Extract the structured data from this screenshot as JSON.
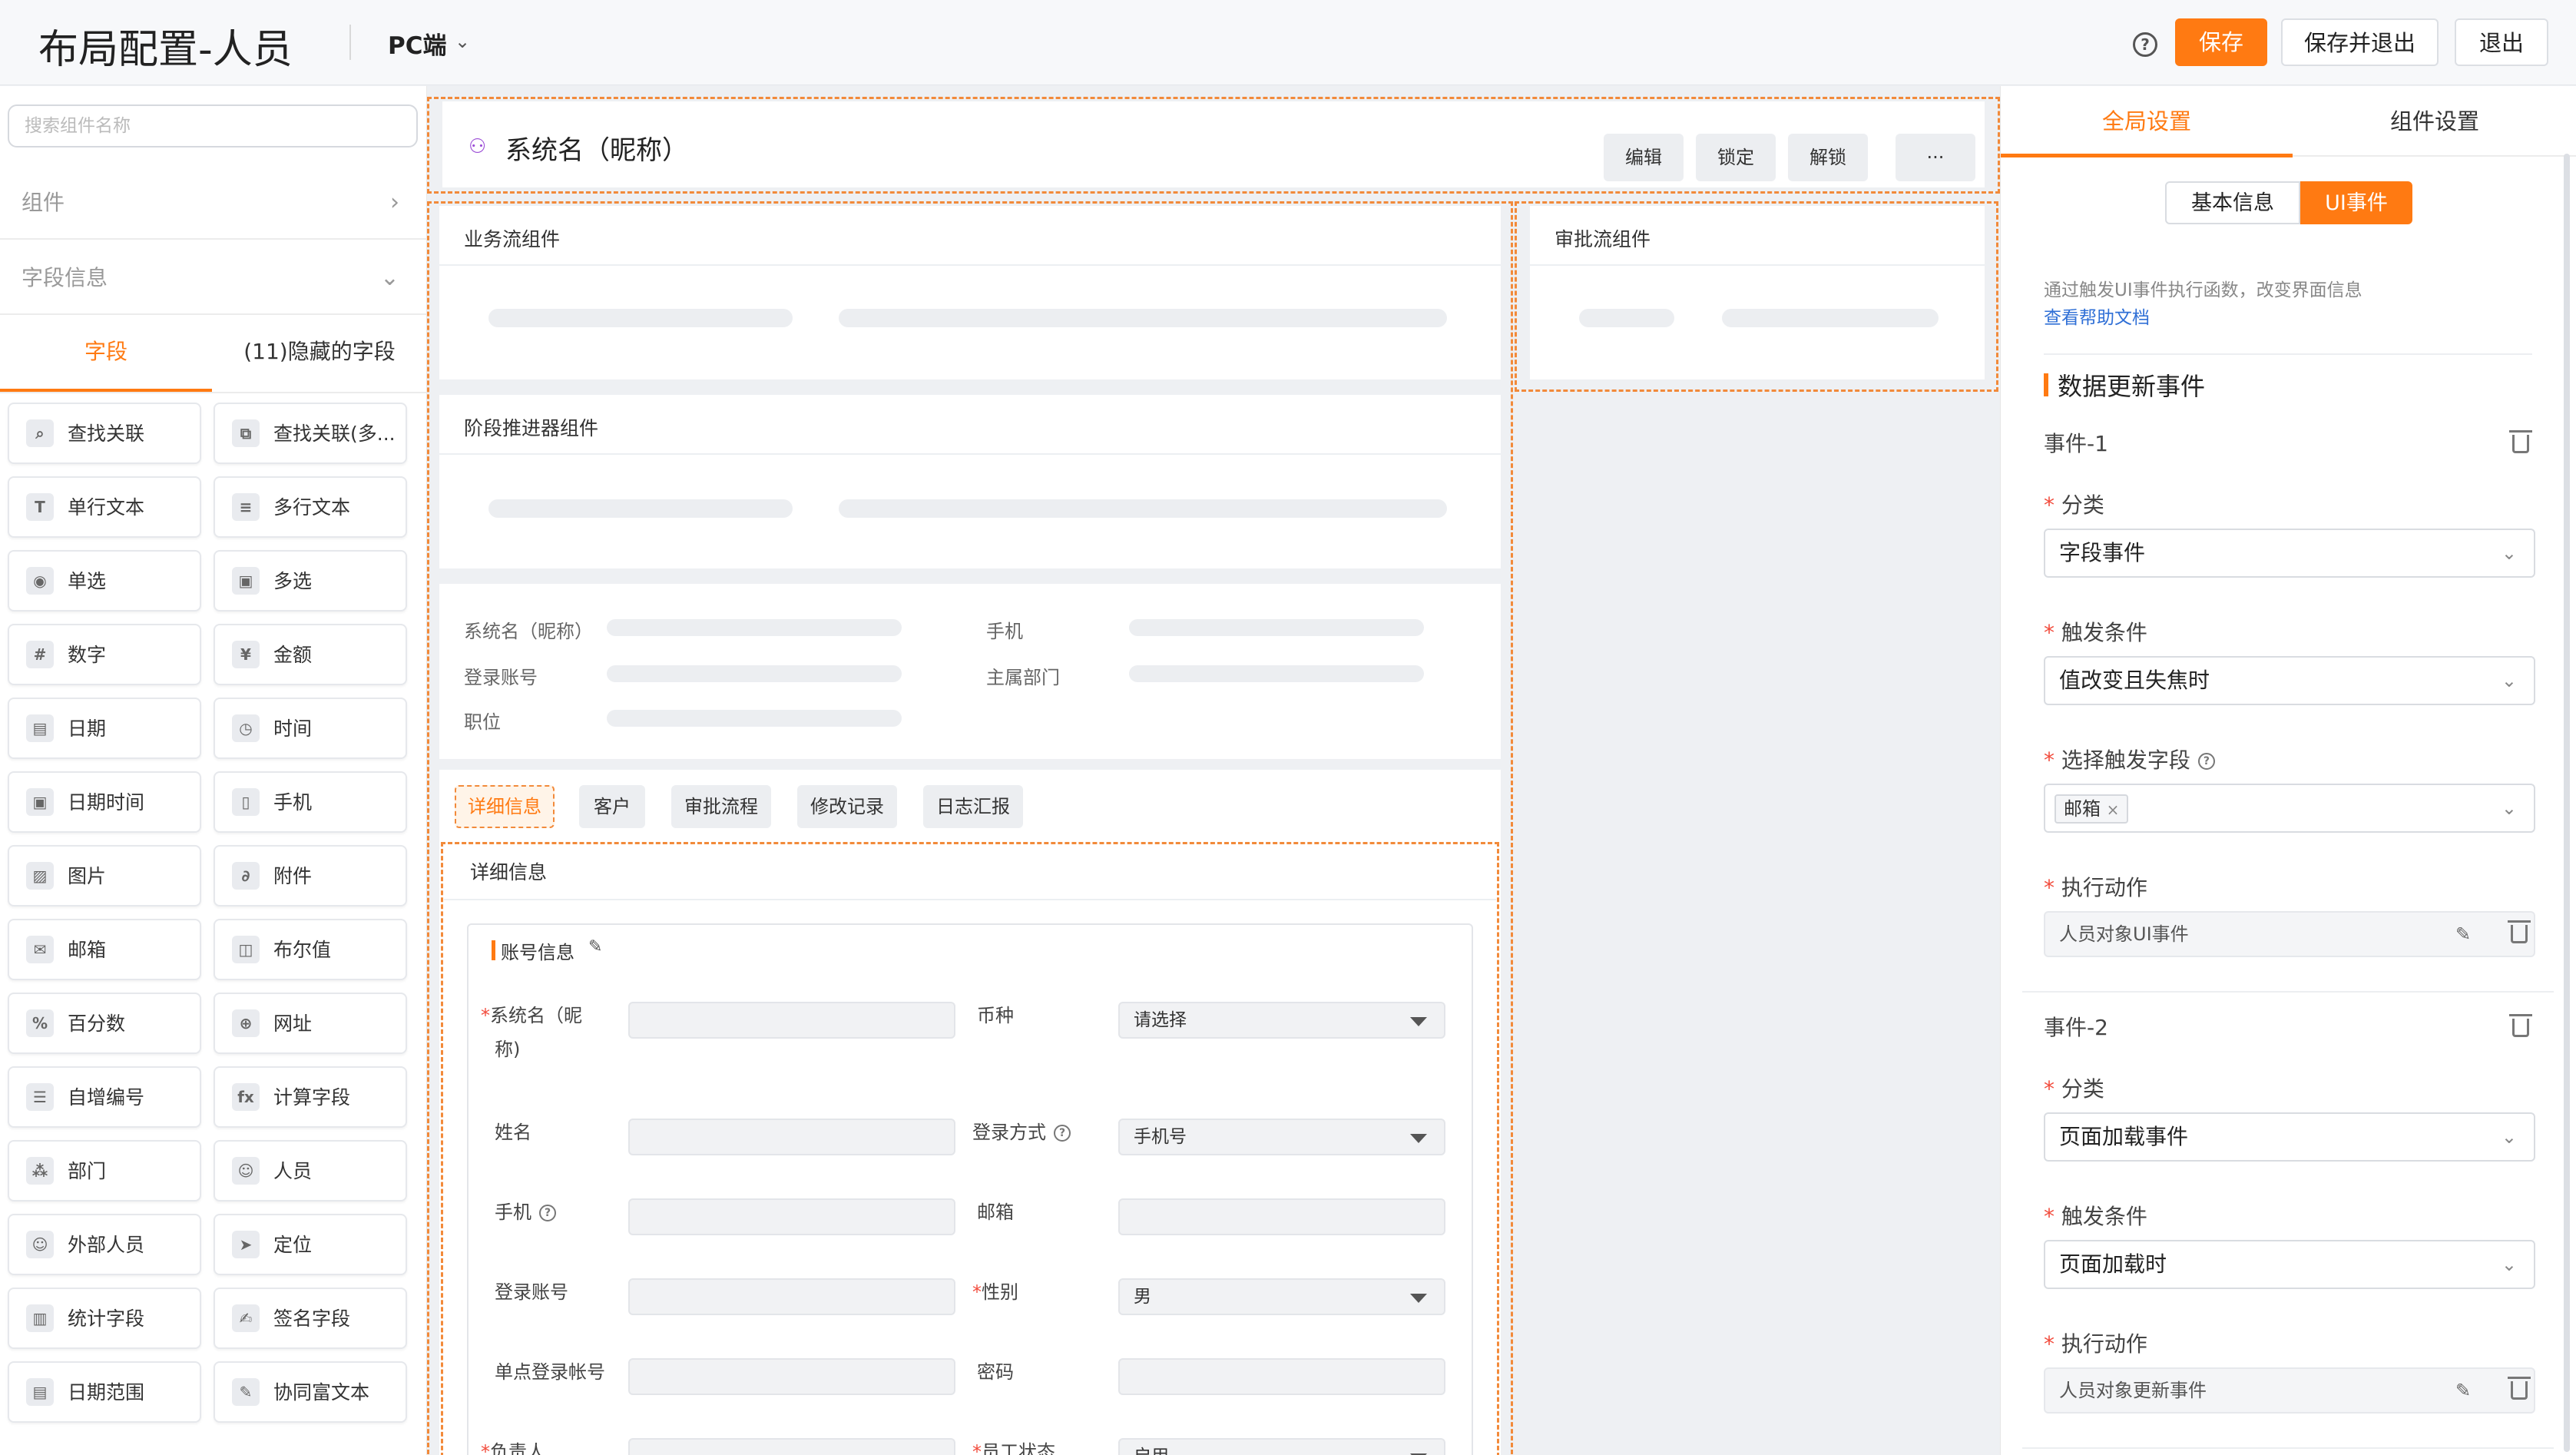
{
  "header": {
    "title": "布局配置-人员",
    "platform": "PC端",
    "help_icon": "?",
    "save": "保存",
    "save_exit": "保存并退出",
    "exit": "退出",
    "accent": "#ff7a12"
  },
  "left": {
    "search_placeholder": "搜索组件名称",
    "section_components": "组件",
    "section_fields": "字段信息",
    "tab_fields": "字段",
    "tab_hidden": "(11)隐藏的字段",
    "items": [
      {
        "label": "查找关联",
        "icon": "lookup-icon",
        "glyph": "⌕"
      },
      {
        "label": "查找关联(多...",
        "icon": "lookup-multi-icon",
        "glyph": "⧉"
      },
      {
        "label": "单行文本",
        "icon": "single-text-icon",
        "glyph": "T"
      },
      {
        "label": "多行文本",
        "icon": "multi-text-icon",
        "glyph": "≡"
      },
      {
        "label": "单选",
        "icon": "radio-icon",
        "glyph": "◉"
      },
      {
        "label": "多选",
        "icon": "checkbox-icon",
        "glyph": "▣"
      },
      {
        "label": "数字",
        "icon": "number-icon",
        "glyph": "#"
      },
      {
        "label": "金额",
        "icon": "currency-icon",
        "glyph": "¥"
      },
      {
        "label": "日期",
        "icon": "date-icon",
        "glyph": "▤"
      },
      {
        "label": "时间",
        "icon": "clock-icon",
        "glyph": "◷"
      },
      {
        "label": "日期时间",
        "icon": "datetime-icon",
        "glyph": "▣"
      },
      {
        "label": "手机",
        "icon": "phone-icon",
        "glyph": "▯"
      },
      {
        "label": "图片",
        "icon": "image-icon",
        "glyph": "▨"
      },
      {
        "label": "附件",
        "icon": "attachment-icon",
        "glyph": "∂"
      },
      {
        "label": "邮箱",
        "icon": "mail-icon",
        "glyph": "✉"
      },
      {
        "label": "布尔值",
        "icon": "boolean-icon",
        "glyph": "◫"
      },
      {
        "label": "百分数",
        "icon": "percent-icon",
        "glyph": "%"
      },
      {
        "label": "网址",
        "icon": "globe-icon",
        "glyph": "⊕"
      },
      {
        "label": "自增编号",
        "icon": "auto-number-icon",
        "glyph": "☰"
      },
      {
        "label": "计算字段",
        "icon": "formula-icon",
        "glyph": "fx"
      },
      {
        "label": "部门",
        "icon": "department-icon",
        "glyph": "⁂"
      },
      {
        "label": "人员",
        "icon": "person-icon",
        "glyph": "☺"
      },
      {
        "label": "外部人员",
        "icon": "external-person-icon",
        "glyph": "☺"
      },
      {
        "label": "定位",
        "icon": "location-icon",
        "glyph": "➤"
      },
      {
        "label": "统计字段",
        "icon": "stats-icon",
        "glyph": "▥"
      },
      {
        "label": "签名字段",
        "icon": "signature-icon",
        "glyph": "✍"
      },
      {
        "label": "日期范围",
        "icon": "date-range-icon",
        "glyph": "▤"
      },
      {
        "label": "协同富文本",
        "icon": "rich-text-icon",
        "glyph": "✎"
      }
    ]
  },
  "canvas": {
    "object_name": "系统名（昵称）",
    "actions": [
      "编辑",
      "锁定",
      "解锁",
      "···"
    ],
    "workflow": "业务流组件",
    "approval_flow": "审批流组件",
    "stage": "阶段推进器组件",
    "info_labels": [
      "系统名（昵称）",
      "手机",
      "登录账号",
      "主属部门",
      "职位"
    ],
    "tabs": [
      "详细信息",
      "客户",
      "审批流程",
      "修改记录",
      "日志汇报"
    ],
    "detail_title": "详细信息",
    "account_info": "账号信息",
    "form": {
      "nickname_1": "系统名（昵",
      "nickname_2": "称)",
      "currency": "币种",
      "currency_value": "请选择",
      "name": "姓名",
      "login_method": "登录方式",
      "login_method_value": "手机号",
      "phone": "手机",
      "email": "邮箱",
      "account": "登录账号",
      "gender": "性别",
      "gender_value": "男",
      "sso": "单点登录帐号",
      "password": "密码",
      "owner": "负责人",
      "status": "员工状态",
      "status_value": "启用"
    }
  },
  "right": {
    "tab_global": "全局设置",
    "tab_component": "组件设置",
    "seg_basic": "基本信息",
    "seg_ui": "UI事件",
    "hint": "通过触发UI事件执行函数，改变界面信息",
    "help_link": "查看帮助文档",
    "heading": "数据更新事件",
    "event1": {
      "title": "事件-1",
      "category_label": "分类",
      "category": "字段事件",
      "trigger_label": "触发条件",
      "trigger": "值改变且失焦时",
      "field_label": "选择触发字段",
      "field_tag": "邮箱",
      "action_label": "执行动作",
      "action": "人员对象UI事件"
    },
    "event2": {
      "title": "事件-2",
      "category_label": "分类",
      "category": "页面加载事件",
      "trigger_label": "触发条件",
      "trigger": "页面加载时",
      "action_label": "执行动作",
      "action": "人员对象更新事件"
    }
  }
}
